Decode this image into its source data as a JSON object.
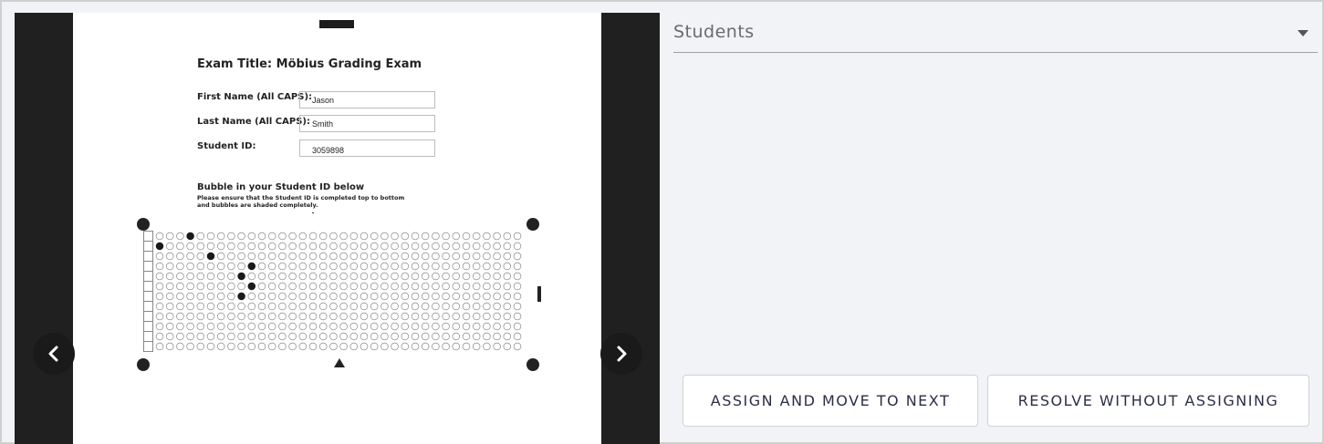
{
  "viewer": {
    "exam_title": "Exam Title: Möbius Grading Exam",
    "fields": [
      {
        "label": "First Name (All CAPS):",
        "value": "Jason"
      },
      {
        "label": "Last Name (All CAPS):",
        "value": "Smith"
      },
      {
        "label": "Student ID:",
        "value": "3059898"
      }
    ],
    "bubble_heading": "Bubble in your Student ID below",
    "bubble_note": "Please ensure that the Student ID is completed top to bottom and bubbles are shaded completely.",
    "bubble_rows": 12,
    "bubble_cols": 36,
    "filled_bubbles": [
      [
        0,
        3
      ],
      [
        1,
        0
      ],
      [
        2,
        5
      ],
      [
        3,
        9
      ],
      [
        4,
        8
      ],
      [
        5,
        9
      ],
      [
        6,
        8
      ]
    ],
    "prev_icon": "chevron-left-icon",
    "next_icon": "chevron-right-icon"
  },
  "panel": {
    "students_label": "Students",
    "dropdown_icon": "caret-down-icon",
    "assign_button": "ASSIGN AND MOVE TO NEXT",
    "resolve_button": "RESOLVE WITHOUT ASSIGNING"
  },
  "colors": {
    "panel_bg": "#f2f3f7",
    "viewer_bg": "#202020",
    "button_text": "#2b2f45"
  }
}
